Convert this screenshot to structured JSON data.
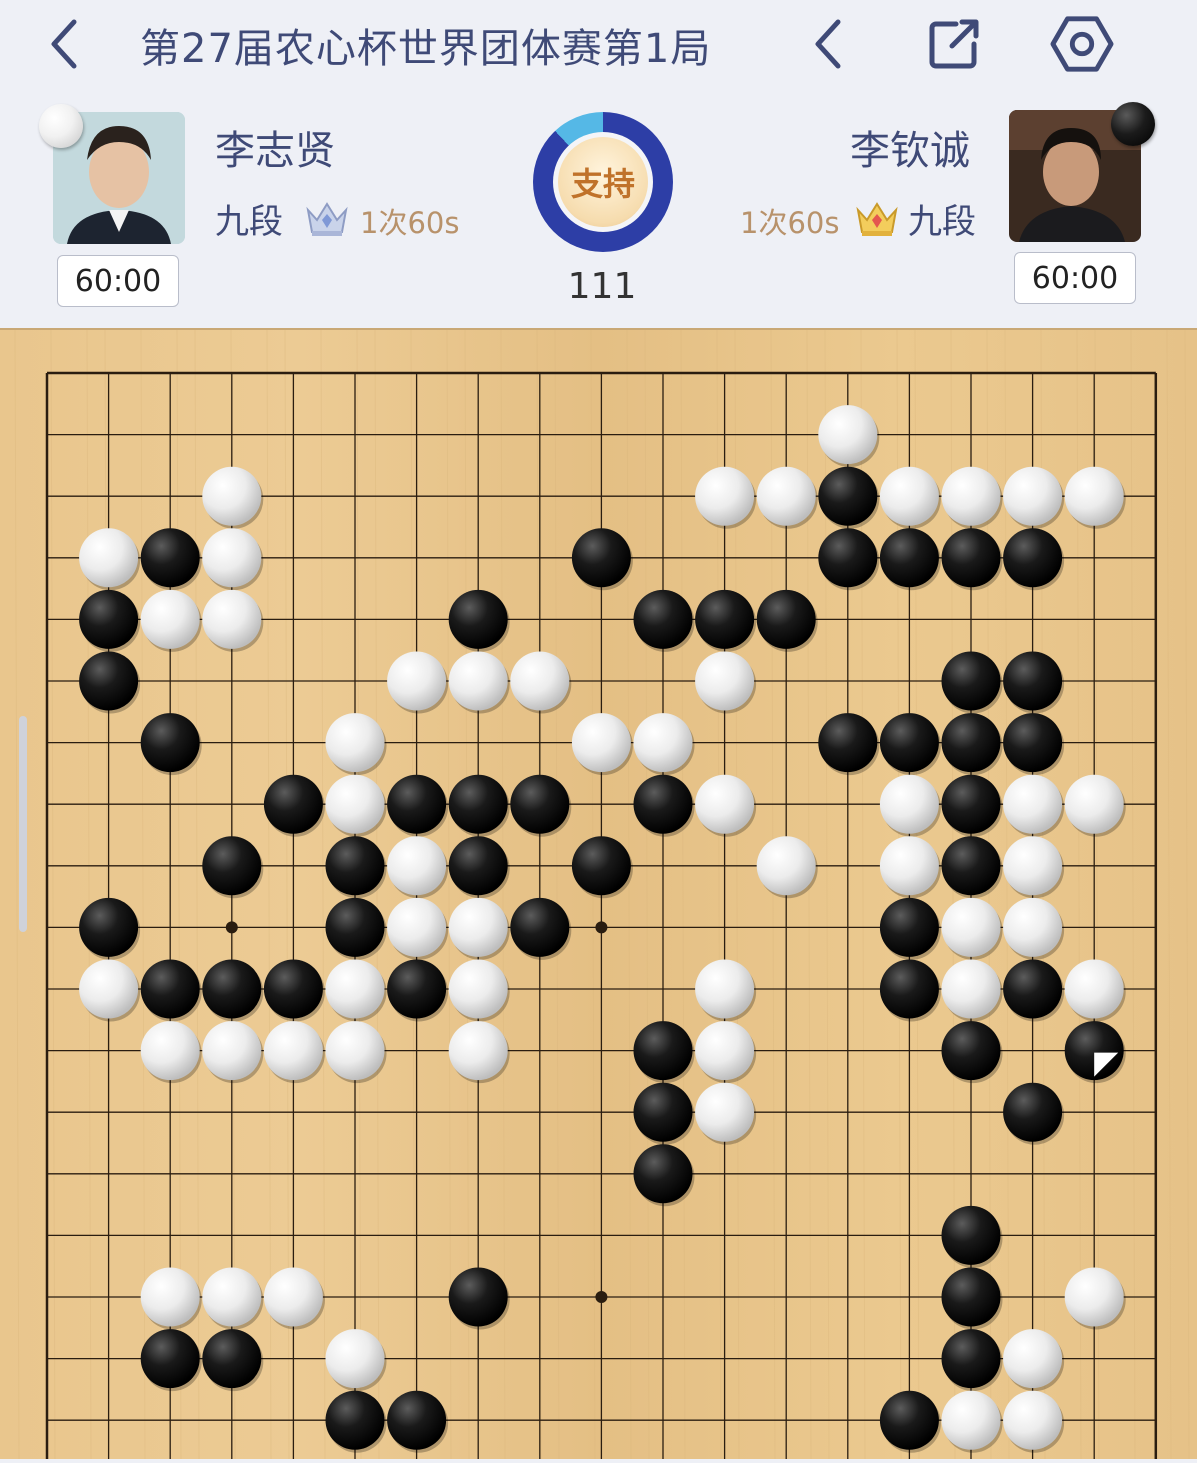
{
  "header": {
    "title": "第27届农心杯世界团体赛第1局",
    "back_icon": "chevron-left-icon",
    "prev_move_icon": "chevron-left-icon",
    "share_icon": "share-icon",
    "settings_icon": "settings-hexagon-icon"
  },
  "players": {
    "white": {
      "name": "李志贤",
      "rank": "九段",
      "byoyomi": "1次60s",
      "clock": "60:00",
      "stone": "white"
    },
    "black": {
      "name": "李钦诚",
      "rank": "九段",
      "byoyomi": "1次60s",
      "clock": "60:00",
      "stone": "black"
    }
  },
  "support": {
    "label": "支持",
    "ratio_black": 0.88
  },
  "move_number": "111",
  "board": {
    "size": 19,
    "visible_rows": 18,
    "star_points": [
      [
        3,
        9
      ],
      [
        9,
        9
      ],
      [
        15,
        9
      ],
      [
        9,
        15
      ]
    ],
    "last_move": [
      17,
      11
    ],
    "stones_black": [
      [
        13,
        2
      ],
      [
        2,
        3
      ],
      [
        9,
        3
      ],
      [
        13,
        3
      ],
      [
        14,
        3
      ],
      [
        15,
        3
      ],
      [
        16,
        3
      ],
      [
        1,
        4
      ],
      [
        7,
        4
      ],
      [
        10,
        4
      ],
      [
        11,
        4
      ],
      [
        12,
        4
      ],
      [
        1,
        5
      ],
      [
        15,
        5
      ],
      [
        16,
        5
      ],
      [
        2,
        6
      ],
      [
        13,
        6
      ],
      [
        14,
        6
      ],
      [
        15,
        6
      ],
      [
        16,
        6
      ],
      [
        4,
        7
      ],
      [
        6,
        7
      ],
      [
        7,
        7
      ],
      [
        8,
        7
      ],
      [
        10,
        7
      ],
      [
        15,
        7
      ],
      [
        3,
        8
      ],
      [
        5,
        8
      ],
      [
        7,
        8
      ],
      [
        9,
        8
      ],
      [
        15,
        8
      ],
      [
        1,
        9
      ],
      [
        5,
        9
      ],
      [
        8,
        9
      ],
      [
        14,
        9
      ],
      [
        2,
        10
      ],
      [
        3,
        10
      ],
      [
        4,
        10
      ],
      [
        6,
        10
      ],
      [
        14,
        10
      ],
      [
        16,
        10
      ],
      [
        10,
        11
      ],
      [
        15,
        11
      ],
      [
        17,
        11
      ],
      [
        10,
        12
      ],
      [
        16,
        12
      ],
      [
        10,
        13
      ],
      [
        15,
        14
      ],
      [
        7,
        15
      ],
      [
        15,
        15
      ],
      [
        2,
        16
      ],
      [
        3,
        16
      ],
      [
        15,
        16
      ],
      [
        5,
        17
      ],
      [
        6,
        17
      ],
      [
        14,
        17
      ]
    ],
    "stones_white": [
      [
        13,
        1
      ],
      [
        3,
        2
      ],
      [
        11,
        2
      ],
      [
        12,
        2
      ],
      [
        14,
        2
      ],
      [
        15,
        2
      ],
      [
        16,
        2
      ],
      [
        17,
        2
      ],
      [
        1,
        3
      ],
      [
        3,
        3
      ],
      [
        2,
        4
      ],
      [
        3,
        4
      ],
      [
        6,
        5
      ],
      [
        7,
        5
      ],
      [
        8,
        5
      ],
      [
        11,
        5
      ],
      [
        5,
        6
      ],
      [
        9,
        6
      ],
      [
        10,
        6
      ],
      [
        5,
        7
      ],
      [
        11,
        7
      ],
      [
        14,
        7
      ],
      [
        16,
        7
      ],
      [
        17,
        7
      ],
      [
        6,
        8
      ],
      [
        12,
        8
      ],
      [
        14,
        8
      ],
      [
        16,
        8
      ],
      [
        6,
        9
      ],
      [
        7,
        9
      ],
      [
        15,
        9
      ],
      [
        16,
        9
      ],
      [
        1,
        10
      ],
      [
        5,
        10
      ],
      [
        7,
        10
      ],
      [
        11,
        10
      ],
      [
        15,
        10
      ],
      [
        17,
        10
      ],
      [
        2,
        11
      ],
      [
        3,
        11
      ],
      [
        4,
        11
      ],
      [
        5,
        11
      ],
      [
        7,
        11
      ],
      [
        11,
        11
      ],
      [
        11,
        12
      ],
      [
        2,
        15
      ],
      [
        3,
        15
      ],
      [
        4,
        15
      ],
      [
        17,
        15
      ],
      [
        5,
        16
      ],
      [
        16,
        16
      ],
      [
        15,
        17
      ],
      [
        16,
        17
      ]
    ]
  }
}
